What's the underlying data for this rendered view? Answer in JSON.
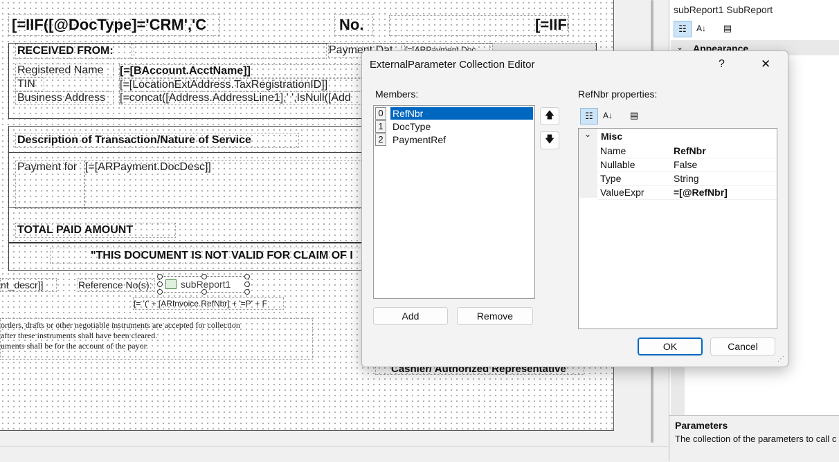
{
  "report": {
    "doc_type_expr": "[=IIF([@DocType]='CRM','C",
    "no_label": "No.",
    "iif_right": "[=IIF(",
    "received_from": "RECEIVED FROM:",
    "payment_date_label": "Payment Dat",
    "payment_date_field": "[=[ARPayment.Doc",
    "registered_name_label": "Registered Name",
    "acct_name_field": "[=[BAccount.AcctName]]",
    "tin_label": "TIN",
    "tin_field": "[=[LocationExtAddress.TaxRegistrationID]]",
    "business_address_label": "Business Address",
    "address_field": "[=concat([Address.AddressLine1],' ',IsNull([Add",
    "description_heading": "Description of Transaction/Nature of Service",
    "payment_for_label": "Payment for",
    "doc_desc_field": "[=[ARPayment.DocDesc]]",
    "total_paid": "TOTAL PAID AMOUNT",
    "not_valid_notice": "\"THIS DOCUMENT IS NOT VALID FOR CLAIM OF I",
    "nt_descr_field": "nt_descr]]",
    "reference_label": "Reference No(s):",
    "subreport_label": "subReport1",
    "invoice_ref_field": "[= '(' + [ARInvoice.RefNbr] + '=P' + F",
    "note_line1": "orders, drafts or other negotiable instruments are accepted for collection",
    "note_line2": "after these instruments shall have been cleared.",
    "note_line3": "uments shall be for the account of the payor.",
    "cashier_label": "Cashier/ Authorized Representative"
  },
  "property_grid": {
    "object_title": "subReport1  SubReport",
    "section_appearance": "Appearance",
    "description_title": "Parameters",
    "description_text": "The collection of the parameters to call c"
  },
  "dialog": {
    "title": "ExternalParameter Collection Editor",
    "help": "?",
    "close": "✕",
    "members_label": "Members:",
    "members": [
      {
        "index": "0",
        "name": "RefNbr"
      },
      {
        "index": "1",
        "name": "DocType"
      },
      {
        "index": "2",
        "name": "PaymentRef"
      }
    ],
    "properties_label": "RefNbr properties:",
    "category": "Misc",
    "properties": [
      {
        "name": "Name",
        "value": "RefNbr"
      },
      {
        "name": "Nullable",
        "value": "False"
      },
      {
        "name": "Type",
        "value": "String"
      },
      {
        "name": "ValueExpr",
        "value": "=[@RefNbr]"
      }
    ],
    "add_label": "Add",
    "remove_label": "Remove",
    "ok_label": "OK",
    "cancel_label": "Cancel"
  },
  "icons": {
    "move_up": "arrow-up-icon",
    "move_down": "arrow-down-icon",
    "categorized": "categorized-icon",
    "alphabetical": "sort-az-icon",
    "property_pages": "property-pages-icon"
  }
}
